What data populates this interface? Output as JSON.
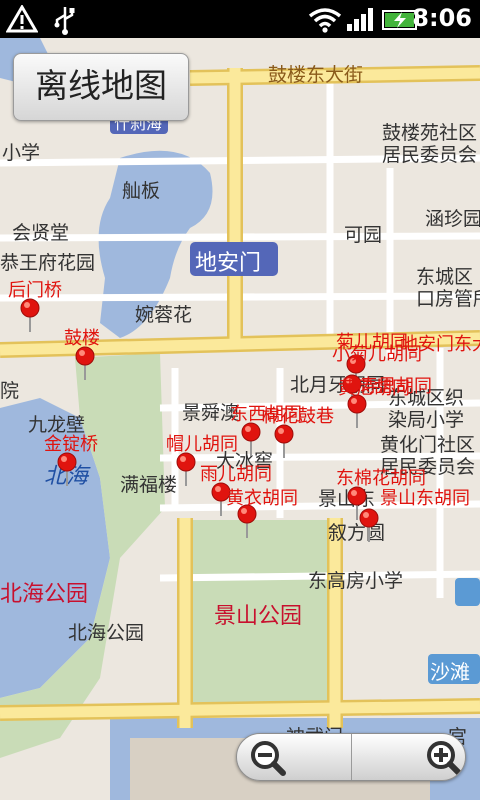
{
  "status_bar": {
    "time": "8:06",
    "icons": [
      "warning-icon",
      "usb-icon",
      "wifi-icon",
      "signal-icon",
      "battery-charging-icon"
    ]
  },
  "offline_button_label": "离线地图",
  "zoom": {
    "out_icon": "zoom-out-icon",
    "in_icon": "zoom-in-icon"
  },
  "map_labels": {
    "gulou_east_street": "鼓楼东大街",
    "gulouyuan_community": "鼓楼苑社区",
    "residents_committee_1": "居民委员会",
    "primary_school_1": "小学",
    "shichahai": "什刹海",
    "shangban": "舢板",
    "huixiantang": "会贤堂",
    "hanzhen": "涵珍园",
    "keyuan": "可园",
    "gongwangfu": "恭王府花园",
    "dianmen": "地安门",
    "dongcheng_district": "东城区",
    "kou_fangguan": "口房管所",
    "wanronghua": "婉蓉花",
    "yuan": "院",
    "beiyue_hutong": "北月牙胡同",
    "dongcheng_zhi": "东城区织",
    "ranju_school": "染局小学",
    "jiulongbi": "九龙壁",
    "jingshun": "景舜澳",
    "huangcheng_community": "黄化门社区",
    "residents_committee_2": "居民委员会",
    "beihai": "北海",
    "manfulou": "满福楼",
    "daren_bingjiao": "大冰窖",
    "jingshan_dong": "景山东",
    "xufangyuan": "叙方圆",
    "donggaofang_school": "东高房小学",
    "beihai_park_red": "北海公园",
    "jingshan_park": "景山公园",
    "beihai_park": "北海公园",
    "shatan": "沙滩",
    "shenwumen": "神武门",
    "gongshi": "宫"
  },
  "markers": [
    {
      "label": "后门桥"
    },
    {
      "label": "鼓楼"
    },
    {
      "label": "金锭桥"
    },
    {
      "label": "帽儿胡同"
    },
    {
      "label": "雨儿胡同"
    },
    {
      "label": "黄衣胡同"
    },
    {
      "label": "东西胡同"
    },
    {
      "label": "棉花鼓巷"
    },
    {
      "label": "菊儿胡同"
    },
    {
      "label": "小菊儿胡同"
    },
    {
      "label": "地安门东大"
    },
    {
      "label": "黄尼胡同"
    },
    {
      "label": "寿思胡同"
    },
    {
      "label": "东棉花胡同"
    },
    {
      "label": "景山东胡同"
    }
  ],
  "colors": {
    "marker_red": "#e0140f",
    "water": "#9fb8dd",
    "park": "#c9dcb7",
    "major_road": "#fbe99b",
    "road_border": "#e3c25a"
  }
}
